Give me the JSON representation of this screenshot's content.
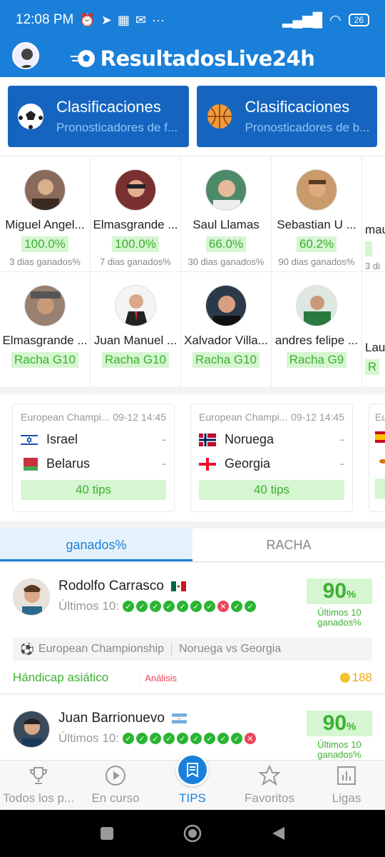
{
  "status": {
    "time": "12:08 PM",
    "more": "···",
    "battery": "26"
  },
  "header": {
    "logo_text": "ResultadosLive24h"
  },
  "classifications": [
    {
      "title": "Clasificaciones",
      "subtitle": "Pronosticadores de f...",
      "icon": "soccer-ball-icon"
    },
    {
      "title": "Clasificaciones",
      "subtitle": "Pronosticadores de b...",
      "icon": "basketball-icon"
    }
  ],
  "top_winrate": [
    {
      "name": "Miguel Angel...",
      "value": "100.0%",
      "sub": "3 dias ganados%"
    },
    {
      "name": "Elmasgrande ...",
      "value": "100.0%",
      "sub": "7 dias ganados%"
    },
    {
      "name": "Saul Llamas",
      "value": "66.0%",
      "sub": "30 dias ganados%"
    },
    {
      "name": "Sebastian U ...",
      "value": "60.2%",
      "sub": "90 dias ganados%"
    },
    {
      "name": "mau",
      "value": "",
      "sub": "3 di"
    }
  ],
  "top_streak": [
    {
      "name": "Elmasgrande ...",
      "value": "Racha G10"
    },
    {
      "name": "Juan Manuel ...",
      "value": "Racha G10"
    },
    {
      "name": "Xalvador Villa...",
      "value": "Racha G10"
    },
    {
      "name": "andres felipe ...",
      "value": "Racha G9"
    },
    {
      "name": "Lau",
      "value": "R"
    }
  ],
  "matches": [
    {
      "league": "European Champi...",
      "time": "09-12 14:45",
      "home": "Israel",
      "away": "Belarus",
      "home_score": "-",
      "away_score": "-",
      "tips": "40 tips"
    },
    {
      "league": "European Champi...",
      "time": "09-12 14:45",
      "home": "Noruega",
      "away": "Georgia",
      "home_score": "-",
      "away_score": "-",
      "tips": "40 tips"
    },
    {
      "league": "Eur",
      "time": "",
      "home": "",
      "away": "",
      "home_score": "",
      "away_score": "",
      "tips": ""
    }
  ],
  "tabs": [
    {
      "label": "ganados%"
    },
    {
      "label": "RACHA"
    }
  ],
  "tipsters": [
    {
      "name": "Rodolfo Carrasco",
      "last10_label": "Últimos 10:",
      "results": [
        "w",
        "w",
        "w",
        "w",
        "w",
        "w",
        "w",
        "l",
        "w",
        "w"
      ],
      "pct": "90",
      "pct_unit": "%",
      "pct_label": "Últimos 10 ganados%",
      "event_league": "European Championship",
      "event_match": "Noruega vs Georgia",
      "market": "Hándicap asiático",
      "analysis": "Análisis",
      "coins": "188"
    },
    {
      "name": "Juan Barrionuevo",
      "last10_label": "Últimos 10:",
      "results": [
        "w",
        "w",
        "w",
        "w",
        "w",
        "w",
        "w",
        "w",
        "w",
        "l"
      ],
      "pct": "90",
      "pct_unit": "%",
      "pct_label": "Últimos 10 ganados%"
    }
  ],
  "bottom_nav": [
    {
      "label": "Todos los p...",
      "icon": "trophy-icon"
    },
    {
      "label": "En curso",
      "icon": "play-circle-icon"
    },
    {
      "label": "TIPS",
      "icon": "tips-icon"
    },
    {
      "label": "Favoritos",
      "icon": "star-icon"
    },
    {
      "label": "Ligas",
      "icon": "chart-icon"
    }
  ],
  "colors": {
    "primary": "#1a7fd9",
    "green": "#3cb130",
    "red": "#e9455a"
  }
}
